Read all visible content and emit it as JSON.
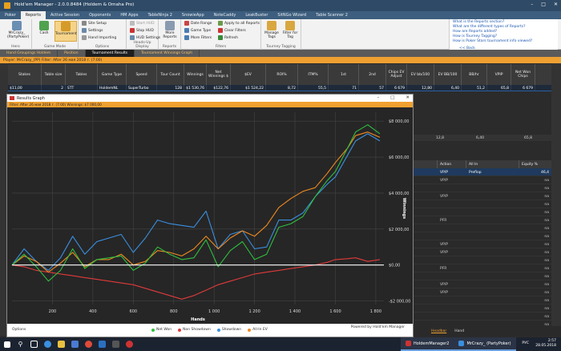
{
  "window": {
    "title": "Hold'em Manager - 2.0.0.8484 (Holdem & Omaha Pro)"
  },
  "menu": [
    "Poker",
    "Reports",
    "Active Session",
    "Opponents",
    "HM Apps",
    "TableNinja 2",
    "SnowieApp",
    "NoteCaddy",
    "LeakBuster",
    "SitNGo Wizard",
    "Table Scanner 2"
  ],
  "ribbon": {
    "hero": {
      "label": "MrCrazy_ (PartyPoker)",
      "group": "Hero"
    },
    "game_mode": {
      "cash": "Cash",
      "tournament": "Tournament",
      "group": "Game Mode"
    },
    "options": {
      "site_setup": "Site Setup",
      "settings": "Settings",
      "hand_importing": "Hand Importing",
      "group": "Options"
    },
    "hud": {
      "start": "Start HUD",
      "stop": "Stop HUD",
      "settings": "HUD Settings",
      "group": "Heads-Up Display"
    },
    "reports": {
      "more": "More Reports",
      "group": "Reports"
    },
    "filters": {
      "date_range": "Date Range",
      "game_type": "Game Type",
      "more": "More Filters",
      "apply_all": "Apply to all Reports",
      "clear": "Clear Filters",
      "refresh": "Refresh",
      "group": "Filters"
    },
    "tagging": {
      "manage": "Manage Tags",
      "filter": "Filter for Tag",
      "group": "Tourney Tagging"
    }
  },
  "help_links": [
    "What is the Reports section?",
    "What are the different types of Reports?",
    "How are Reports added?",
    "How is Tourney Tagging?",
    "How is Poker Stars tournament info viewed?"
  ],
  "help_back": "<< Back",
  "tabs": [
    "Hand Groupings Holdem",
    "Position",
    "Tournament Results",
    "Tournament Winnings Graph"
  ],
  "filterbar": "Player: MrCrazy_(PP)   Filter: After 26 мая 2018 г. (7:00)",
  "grid": {
    "headers": [
      "Stakes",
      "Table size",
      "Tables",
      "Game Type",
      "Speed",
      "Tour Count",
      "Winnings",
      "Net Winnings $",
      "$EV",
      "ROI%",
      "ITM%",
      "1st",
      "2nd",
      "Chips EV Adjust",
      "EV bb/100",
      "EV BB/100",
      "BB/hr",
      "VPIP",
      "Net Won Chips"
    ],
    "row": [
      "$11,00",
      "2",
      "STT",
      "HoldemNL",
      "SuperTurbo",
      "128",
      "$1 530,76",
      "$122,76",
      "$1 524,22",
      "8,72",
      "55,5",
      "71",
      "57",
      "6 679",
      "12,80",
      "6,40",
      "51,2",
      "65,8",
      "6 679"
    ]
  },
  "bg_row": [
    "12,8",
    "6,40",
    "65,8"
  ],
  "actions": {
    "headers": [
      "Action",
      "All In",
      "Equity %"
    ],
    "rows": [
      {
        "pos": "",
        "act": "VP/P",
        "allin": "Preflop",
        "eq": "46,4"
      },
      {
        "pos": "",
        "act": "VP/P",
        "allin": "",
        "eq": "na"
      },
      {
        "pos": "",
        "act": "",
        "allin": "",
        "eq": "na"
      },
      {
        "pos": "",
        "act": "VP/P",
        "allin": "",
        "eq": "na"
      },
      {
        "pos": "",
        "act": "",
        "allin": "",
        "eq": "na"
      },
      {
        "pos": "",
        "act": "",
        "allin": "",
        "eq": "na"
      },
      {
        "pos": "",
        "act": "PFR",
        "allin": "",
        "eq": "na"
      },
      {
        "pos": "",
        "act": "",
        "allin": "",
        "eq": "na"
      },
      {
        "pos": "",
        "act": "",
        "allin": "",
        "eq": "na"
      },
      {
        "pos": "",
        "act": "VP/P",
        "allin": "",
        "eq": "na"
      },
      {
        "pos": "",
        "act": "VP/P",
        "allin": "",
        "eq": "na"
      },
      {
        "pos": "",
        "act": "",
        "allin": "",
        "eq": "na"
      },
      {
        "pos": "",
        "act": "PFR",
        "allin": "",
        "eq": "na"
      },
      {
        "pos": "",
        "act": "",
        "allin": "",
        "eq": "na"
      },
      {
        "pos": "",
        "act": "VP/P",
        "allin": "",
        "eq": "na"
      },
      {
        "pos": "",
        "act": "VP/P",
        "allin": "",
        "eq": "na"
      },
      {
        "pos": "",
        "act": "",
        "allin": "",
        "eq": "na"
      },
      {
        "pos": "",
        "act": "",
        "allin": "",
        "eq": "na"
      },
      {
        "pos": "",
        "act": "",
        "allin": "",
        "eq": "na"
      },
      {
        "pos": "",
        "act": "",
        "allin": "",
        "eq": "na"
      }
    ]
  },
  "graph_window": {
    "title": "Results Graph",
    "filter": "Filter: After 26 мая 2018 г. (7:00)   Winnings: $7 000,00",
    "options": "Options",
    "powered": "Powered by Hold'em Manager"
  },
  "chart_data": {
    "type": "line",
    "xlabel": "Hands",
    "ylabel": "Winnings",
    "xlim": [
      0,
      1840
    ],
    "ylim": [
      -2200,
      8500
    ],
    "xticks": [
      "200",
      "400",
      "600",
      "800",
      "1 000",
      "1 200",
      "1 400",
      "1 600",
      "1 800"
    ],
    "xtick_values": [
      200,
      400,
      600,
      800,
      1000,
      1200,
      1400,
      1600,
      1800
    ],
    "yticks": [
      "-$2 000,00",
      "$0,00",
      "$2 000,00",
      "$4 000,00",
      "$6 000,00",
      "$8 000,00"
    ],
    "ytick_values": [
      -2000,
      0,
      2000,
      4000,
      6000,
      8000
    ],
    "grid": true,
    "legend_position": "bottom",
    "series": [
      {
        "name": "Net Won",
        "color": "#2fbf3f",
        "x": [
          0,
          60,
          120,
          180,
          240,
          300,
          360,
          420,
          480,
          540,
          600,
          660,
          720,
          780,
          840,
          900,
          960,
          1020,
          1080,
          1140,
          1200,
          1260,
          1320,
          1380,
          1440,
          1500,
          1560,
          1600,
          1660,
          1700,
          1760,
          1820
        ],
        "y": [
          0,
          600,
          -100,
          -900,
          -300,
          900,
          -200,
          300,
          400,
          500,
          -300,
          100,
          1000,
          600,
          300,
          400,
          1400,
          -100,
          800,
          1300,
          300,
          600,
          2100,
          2300,
          2700,
          3800,
          4700,
          5200,
          6500,
          7400,
          7800,
          7300
        ]
      },
      {
        "name": "Non Showdown",
        "color": "#e03a3a",
        "x": [
          0,
          60,
          120,
          180,
          240,
          300,
          360,
          420,
          480,
          540,
          600,
          660,
          720,
          780,
          840,
          900,
          960,
          1020,
          1080,
          1140,
          1200,
          1260,
          1320,
          1380,
          1440,
          1500,
          1560,
          1600,
          1660,
          1700,
          1760,
          1820
        ],
        "y": [
          0,
          -100,
          -300,
          -400,
          -500,
          -600,
          -700,
          -800,
          -900,
          -1000,
          -1100,
          -1300,
          -1500,
          -1700,
          -1900,
          -1700,
          -1400,
          -1100,
          -900,
          -700,
          -500,
          -400,
          -300,
          -200,
          -100,
          0,
          150,
          300,
          350,
          400,
          200,
          300
        ]
      },
      {
        "name": "Showdown",
        "color": "#3a8fe0",
        "x": [
          0,
          60,
          120,
          180,
          240,
          300,
          360,
          420,
          480,
          540,
          600,
          660,
          720,
          780,
          840,
          900,
          960,
          1020,
          1080,
          1140,
          1200,
          1260,
          1320,
          1380,
          1440,
          1500,
          1560,
          1600,
          1660,
          1700,
          1760,
          1820
        ],
        "y": [
          0,
          900,
          200,
          -300,
          400,
          1600,
          600,
          1300,
          1500,
          1700,
          700,
          1500,
          2500,
          2300,
          2200,
          2100,
          3000,
          900,
          1700,
          1900,
          900,
          1000,
          2500,
          2500,
          2900,
          3800,
          4500,
          4900,
          6100,
          6900,
          7300,
          6900
        ]
      },
      {
        "name": "All-In EV",
        "color": "#f08a20",
        "x": [
          0,
          60,
          120,
          180,
          240,
          300,
          360,
          420,
          480,
          540,
          600,
          660,
          720,
          780,
          840,
          900,
          960,
          1020,
          1080,
          1140,
          1200,
          1260,
          1320,
          1380,
          1440,
          1500,
          1560,
          1600,
          1660,
          1700,
          1760,
          1820
        ],
        "y": [
          0,
          500,
          200,
          -400,
          100,
          700,
          -100,
          300,
          300,
          600,
          0,
          200,
          800,
          700,
          500,
          900,
          1600,
          900,
          1500,
          1900,
          1600,
          2200,
          3200,
          3700,
          4100,
          4300,
          5100,
          5700,
          6500,
          7200,
          7400,
          7100
        ]
      },
      {
        "name": "Baseline",
        "color": "#ffffff",
        "x": [
          0,
          1840
        ],
        "y": [
          0,
          0
        ]
      }
    ]
  },
  "taskbar": {
    "app1": "HoldemManager2",
    "app2": "MrCrazy_ (PartyPoker)",
    "lang": "РУС",
    "time": "2:57",
    "date": "28.05.2018"
  },
  "statusstrip": {
    "headbar": "Headbar",
    "hand": "Hand"
  }
}
